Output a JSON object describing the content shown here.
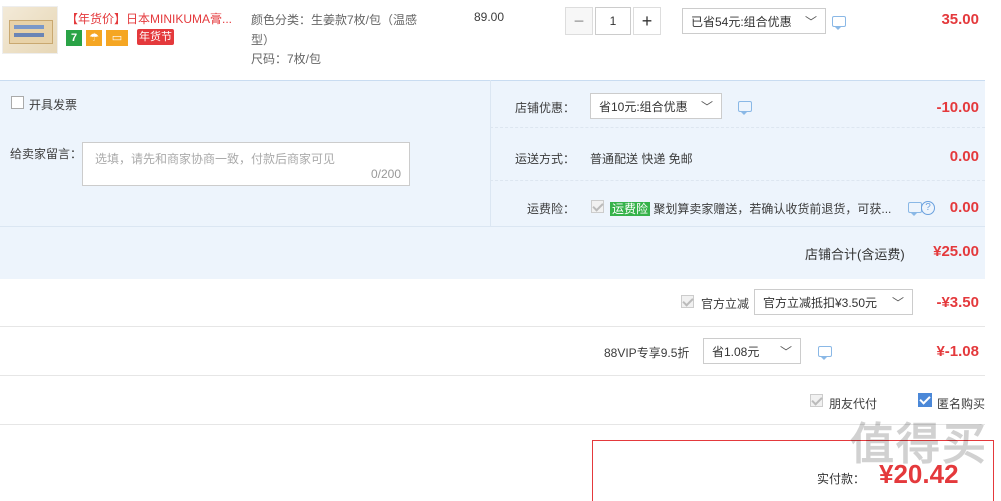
{
  "product": {
    "title": "【年货价】日本MINIKUMA膏...",
    "tag_7": "7",
    "tag_festival": "年货节",
    "sku_color": "颜色分类：生姜款7枚/包（温感型）",
    "sku_size": "尺码：7枚/包",
    "unit_price": "89.00",
    "quantity": "1",
    "minus": "−",
    "plus": "+",
    "promo_select": "已省54元:组合优惠",
    "subtotal": "35.00"
  },
  "invoice": {
    "label": "开具发票"
  },
  "message": {
    "label": "给卖家留言：",
    "placeholder": "选填，请先和商家协商一致，付款后商家可见",
    "counter": "0/200"
  },
  "shop_discount": {
    "label": "店铺优惠：",
    "select": "省10元:组合优惠",
    "amount": "-10.00"
  },
  "shipping": {
    "label": "运送方式：",
    "value": "普通配送 快递 免邮",
    "amount": "0.00"
  },
  "insurance": {
    "label": "运费险：",
    "badge": "运费险",
    "text": "聚划算卖家赠送，若确认收货前退货，可获...",
    "amount": "0.00"
  },
  "shop_total": {
    "label": "店铺合计(含运费)",
    "amount": "¥25.00"
  },
  "official": {
    "label": "官方立减",
    "select": "官方立减抵扣¥3.50元",
    "amount": "-¥3.50"
  },
  "vip": {
    "label": "88VIP专享9.5折",
    "select": "省1.08元",
    "amount": "¥-1.08"
  },
  "options": {
    "friend_pay": "朋友代付",
    "anonymous": "匿名购买"
  },
  "pay": {
    "label": "实付款：",
    "amount": "¥20.42"
  },
  "watermark": "值得买"
}
